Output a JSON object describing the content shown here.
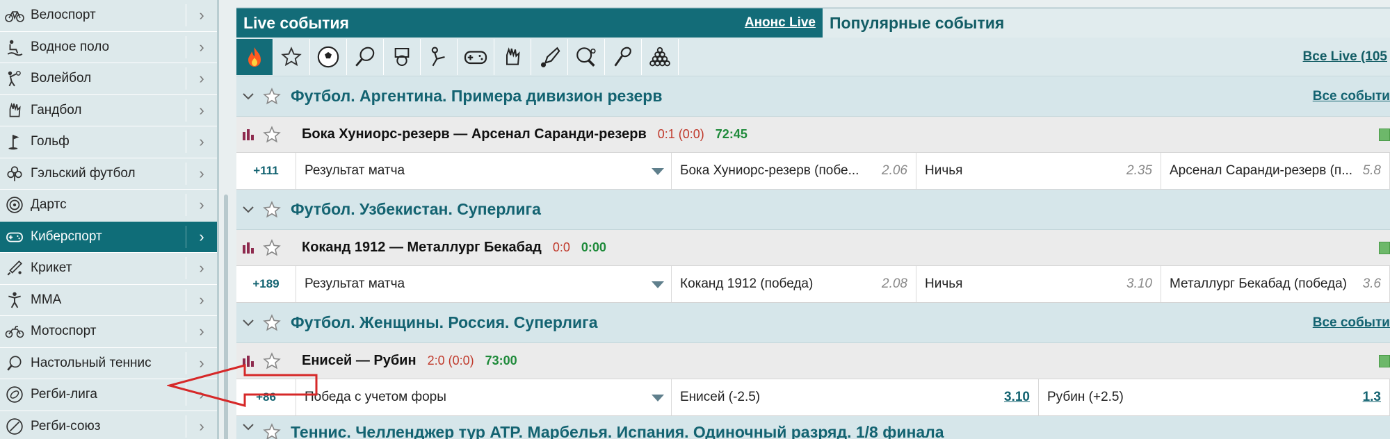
{
  "sidebar": {
    "items": [
      {
        "label": "Велоспорт",
        "icon": "bicycle-icon",
        "active": false
      },
      {
        "label": "Водное поло",
        "icon": "water-polo-icon",
        "active": false
      },
      {
        "label": "Волейбол",
        "icon": "volleyball-icon",
        "active": false
      },
      {
        "label": "Гандбол",
        "icon": "handball-icon",
        "active": false
      },
      {
        "label": "Гольф",
        "icon": "golf-icon",
        "active": false
      },
      {
        "label": "Гэльский футбол",
        "icon": "clover-icon",
        "active": false
      },
      {
        "label": "Дартс",
        "icon": "darts-icon",
        "active": false
      },
      {
        "label": "Киберспорт",
        "icon": "gamepad-icon",
        "active": true
      },
      {
        "label": "Крикет",
        "icon": "cricket-icon",
        "active": false
      },
      {
        "label": "ММА",
        "icon": "mma-icon",
        "active": false
      },
      {
        "label": "Мотоспорт",
        "icon": "motorbike-icon",
        "active": false
      },
      {
        "label": "Настольный теннис",
        "icon": "table-tennis-icon",
        "active": false
      },
      {
        "label": "Регби-лига",
        "icon": "rugby-league-icon",
        "active": false
      },
      {
        "label": "Регби-союз",
        "icon": "rugby-union-icon",
        "active": false
      }
    ],
    "arrow": "›"
  },
  "tabs": {
    "live_title": "Live события",
    "anons_link": "Анонс Live",
    "popular_title": "Популярные события"
  },
  "sportbar": {
    "icons": [
      "fire-icon",
      "star-icon",
      "soccer-ball-icon",
      "tennis-racket-icon",
      "basketball-icon",
      "hockey-icon",
      "gamepad-icon",
      "handball-icon",
      "badminton-icon",
      "table-tennis-icon",
      "squash-icon",
      "billiards-icon"
    ],
    "all_live": "Все Live (105"
  },
  "leagues": [
    {
      "name": "Футбол. Аргентина. Примера дивизион резерв",
      "all": "Все событи",
      "match": {
        "teams": "Бока Хуниорс-резерв — Арсенал Саранди-резерв",
        "score": "0:1 (0:0)",
        "time": "72:45"
      },
      "odds": {
        "more": "+111",
        "market": "Результат матча",
        "outcomes": [
          {
            "name": "Бока Хуниорс-резерв (побе...",
            "value": "2.06"
          },
          {
            "name": "Ничья",
            "value": "2.35"
          },
          {
            "name": "Арсенал Саранди-резерв (п...",
            "value": "5.8"
          }
        ]
      }
    },
    {
      "name": "Футбол. Узбекистан. Суперлига",
      "all": "",
      "match": {
        "teams": "Коканд 1912 — Металлург Бекабад",
        "score": "0:0",
        "time": "0:00"
      },
      "odds": {
        "more": "+189",
        "market": "Результат матча",
        "outcomes": [
          {
            "name": "Коканд 1912 (победа)",
            "value": "2.08"
          },
          {
            "name": "Ничья",
            "value": "3.10"
          },
          {
            "name": "Металлург Бекабад (победа)",
            "value": "3.6"
          }
        ]
      }
    },
    {
      "name": "Футбол. Женщины. Россия. Суперлига",
      "all": "Все событи",
      "match": {
        "teams": "Енисей — Рубин",
        "score": "2:0 (0:0)",
        "time": "73:00"
      },
      "odds": {
        "more": "+86",
        "market": "Победа с учетом форы",
        "outcomes": [
          {
            "name": "Енисей  (-2.5)",
            "value": "3.10"
          },
          {
            "name": "Рубин  (+2.5)",
            "value": "1.3"
          }
        ]
      }
    }
  ],
  "partial_league": "Теннис. Челленджер тур ATP. Марбелья. Испания. Одиночный разряд. 1/8 финала"
}
